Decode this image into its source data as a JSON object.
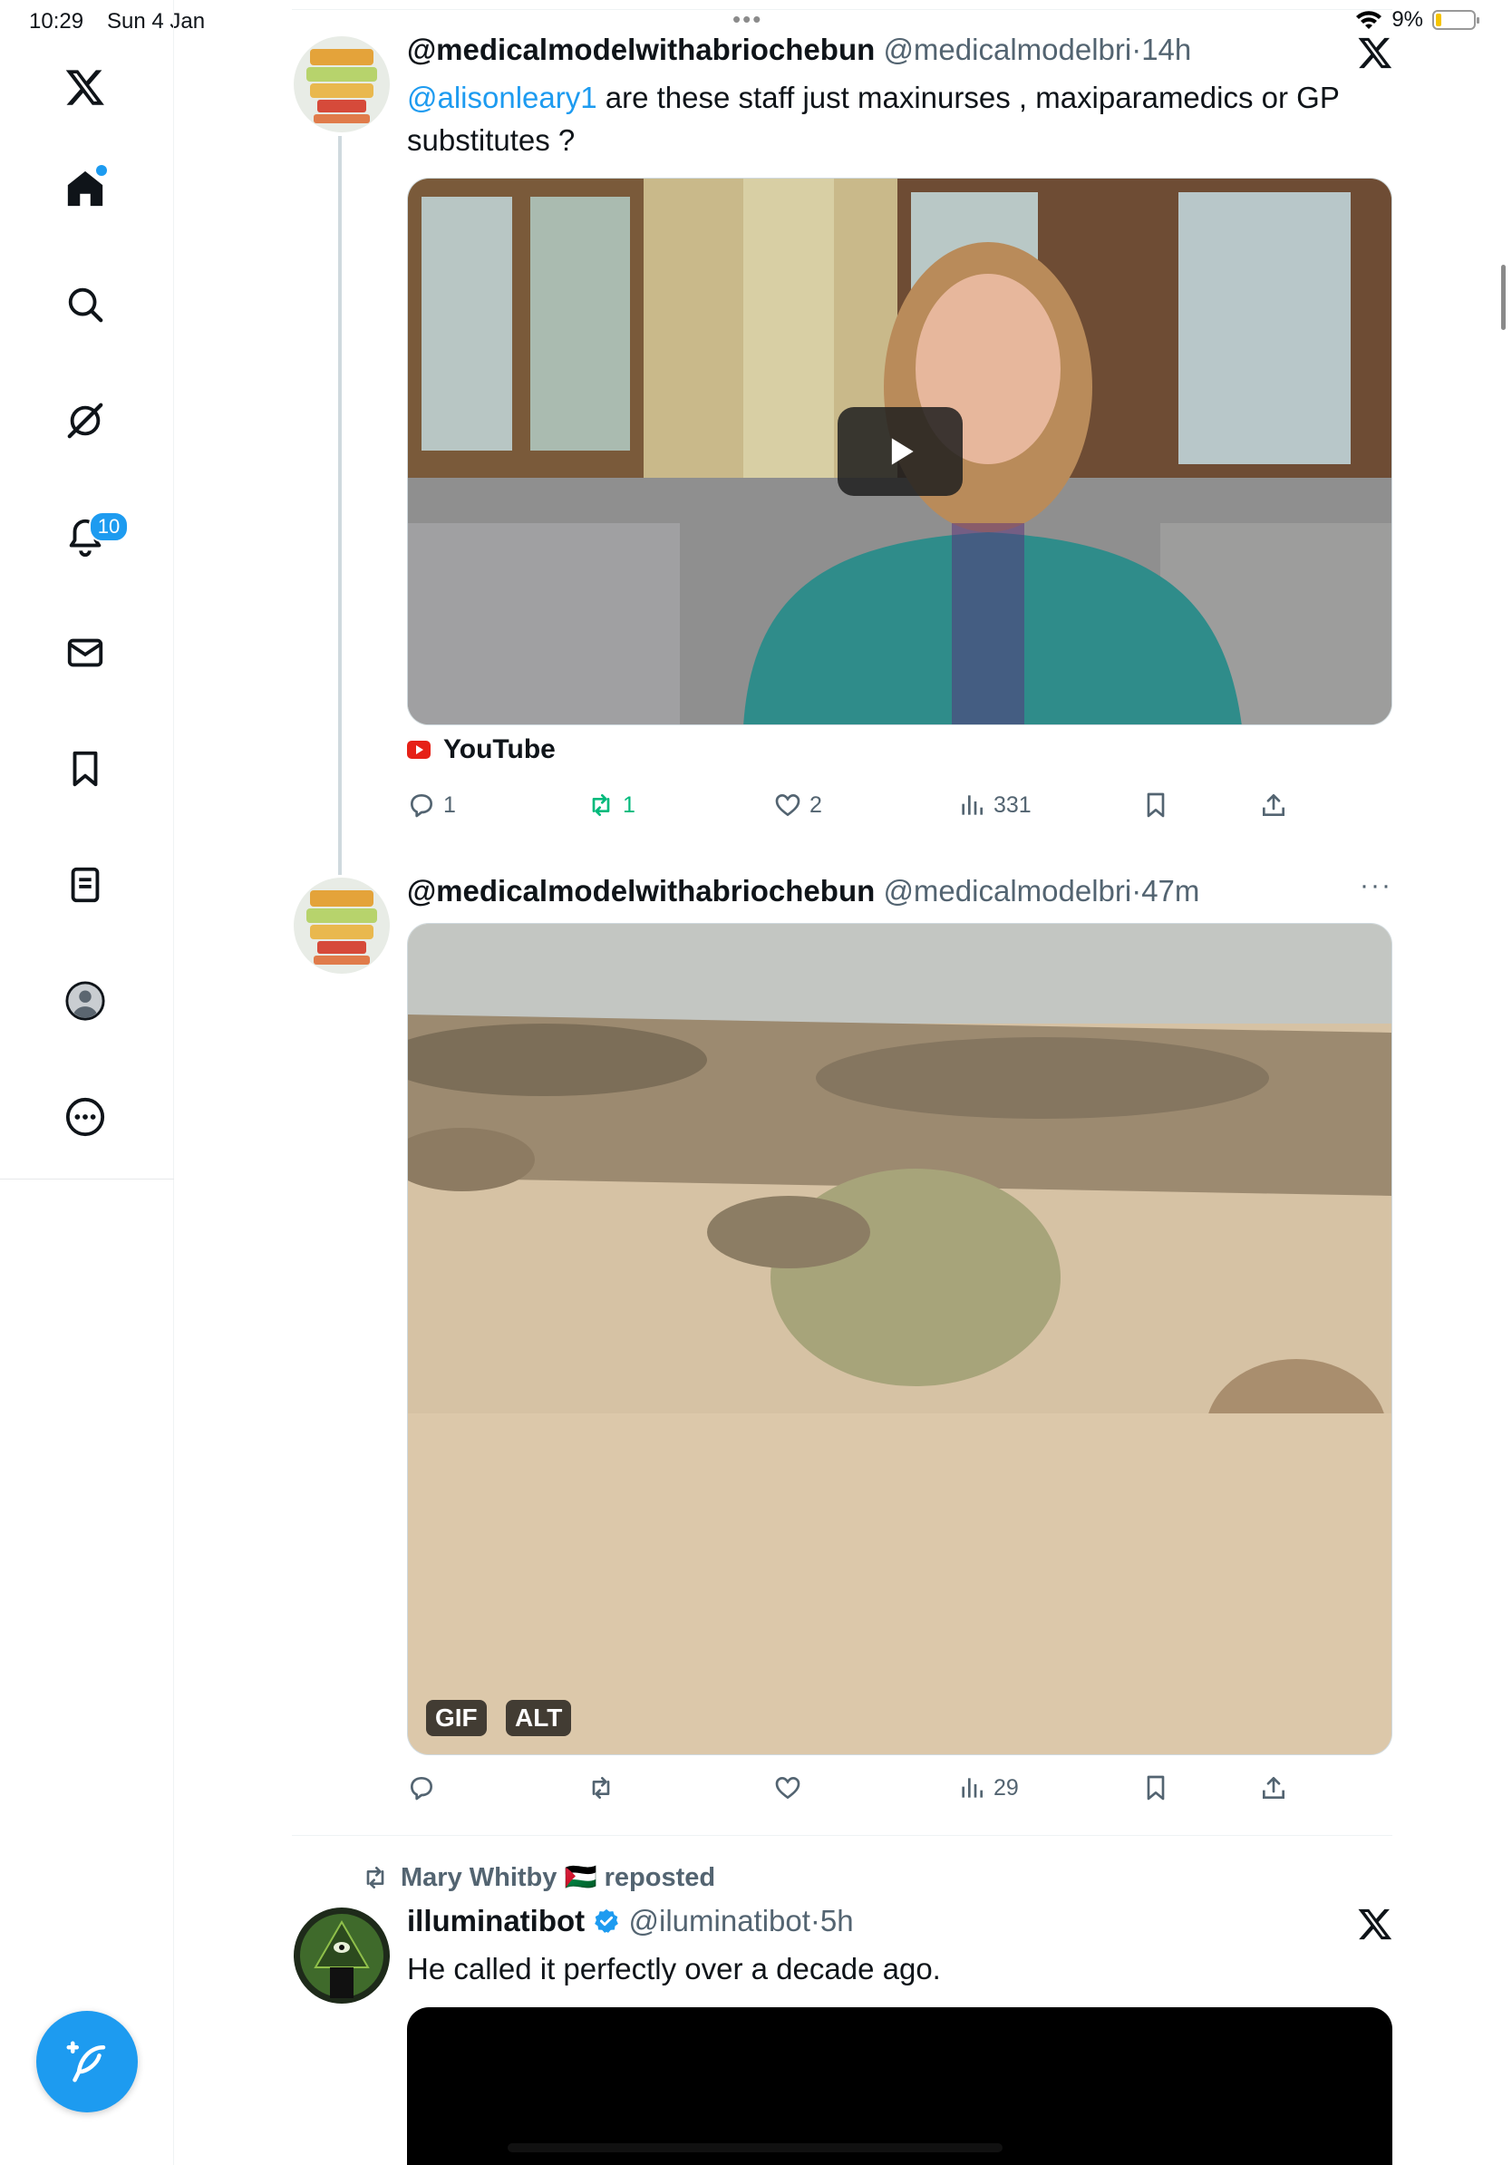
{
  "status_bar": {
    "time": "10:29",
    "date": "Sun 4 Jan",
    "battery": "9%"
  },
  "sidebar": {
    "items": [
      {
        "name": "x-logo"
      },
      {
        "name": "home"
      },
      {
        "name": "search"
      },
      {
        "name": "grok"
      },
      {
        "name": "notifications"
      },
      {
        "name": "messages"
      },
      {
        "name": "bookmarks"
      },
      {
        "name": "lists"
      },
      {
        "name": "profile"
      },
      {
        "name": "more"
      }
    ],
    "notifications_badge": "10"
  },
  "tweets": [
    {
      "name": "@medicalmodelwithabriochebun",
      "handle": "@medicalmodelbri",
      "sep": "·",
      "time": "14h",
      "mention": "@alisonleary1",
      "text": " are these staff just maxinurses , maxiparamedics or GP substitutes ?",
      "link_source": "YouTube",
      "replies": "1",
      "reposts": "1",
      "likes": "2",
      "views": "331"
    },
    {
      "name": "@medicalmodelwithabriochebun",
      "handle": "@medicalmodelbri",
      "sep": "·",
      "time": "47m",
      "gif_label": "GIF",
      "alt_label": "ALT",
      "views": "29"
    },
    {
      "repost_by": "Mary Whitby 🇵🇸 reposted",
      "name": "illuminatibot",
      "handle": "@iluminatibot",
      "sep": "·",
      "time": "5h",
      "text": "He called it perfectly over a decade ago."
    }
  ],
  "colors": {
    "accent": "#1d9bf0",
    "repost_green": "#00ba7c",
    "muted": "#536471"
  }
}
